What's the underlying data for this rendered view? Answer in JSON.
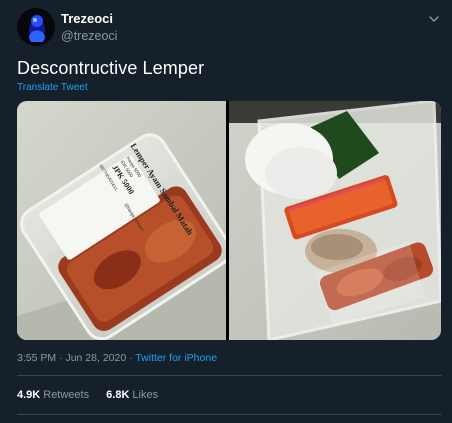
{
  "user": {
    "display_name": "Trezeoci",
    "handle": "@trezeoci"
  },
  "tweet": {
    "text": "Descontructive Lemper",
    "translate_label": "Translate Tweet",
    "time": "3:55 PM",
    "separator": " · ",
    "date": "Jun 28, 2020",
    "via": "Twitter for iPhone"
  },
  "stats": {
    "retweets_count": "4.9K",
    "retweets_label": "Retweets",
    "likes_count": "6.8K",
    "likes_label": "Likes"
  },
  "photo_label": {
    "line1": "Lemper Ayam Sambal Matah",
    "line2": "Harga 5000",
    "line3": "IDR 5000",
    "line4": "JPK 5000",
    "line5": "087745431611",
    "line6": "@harga_lemper"
  },
  "colors": {
    "background": "#15202b",
    "link": "#1da1f2",
    "secondary_text": "#8899a6",
    "divider": "#38444d"
  },
  "icons": {
    "avatar": "blue-figure-avatar",
    "more": "chevron-down-icon"
  }
}
